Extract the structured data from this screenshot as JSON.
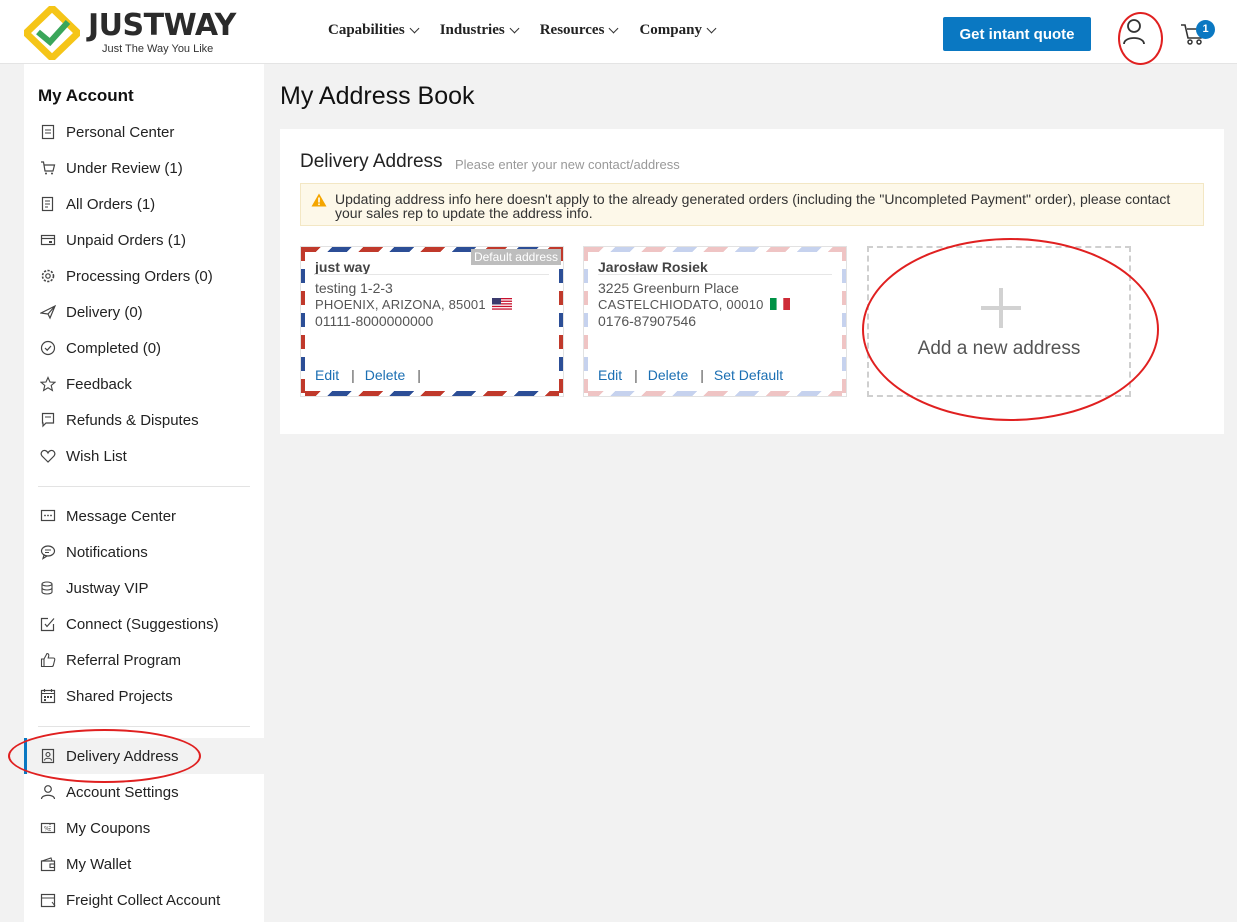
{
  "header": {
    "brand": "JUSTWAY",
    "tagline": "Just The Way You Like",
    "nav": [
      {
        "label": "Capabilities"
      },
      {
        "label": "Industries"
      },
      {
        "label": "Resources"
      },
      {
        "label": "Company"
      }
    ],
    "quote_button": "Get intant quote",
    "cart_count": "1"
  },
  "sidebar": {
    "title": "My Account",
    "group1": [
      {
        "label": "Personal Center",
        "icon": "document-icon"
      },
      {
        "label": "Under Review (1)",
        "icon": "cart-icon"
      },
      {
        "label": "All Orders (1)",
        "icon": "orders-icon"
      },
      {
        "label": "Unpaid Orders (1)",
        "icon": "card-icon"
      },
      {
        "label": "Processing Orders (0)",
        "icon": "gear-icon"
      },
      {
        "label": "Delivery (0)",
        "icon": "plane-icon"
      },
      {
        "label": "Completed (0)",
        "icon": "check-circle-icon"
      },
      {
        "label": "Feedback",
        "icon": "star-icon"
      },
      {
        "label": "Refunds & Disputes",
        "icon": "flag-icon"
      },
      {
        "label": "Wish List",
        "icon": "heart-icon"
      }
    ],
    "group2": [
      {
        "label": "Message Center",
        "icon": "message-icon"
      },
      {
        "label": "Notifications",
        "icon": "chat-icon"
      },
      {
        "label": "Justway VIP",
        "icon": "coins-icon"
      },
      {
        "label": "Connect (Suggestions)",
        "icon": "edit-check-icon"
      },
      {
        "label": "Referral Program",
        "icon": "thumbs-up-icon"
      },
      {
        "label": "Shared Projects",
        "icon": "calendar-icon"
      }
    ],
    "group3": [
      {
        "label": "Delivery Address",
        "icon": "address-book-icon"
      },
      {
        "label": "Account Settings",
        "icon": "user-icon"
      },
      {
        "label": "My Coupons",
        "icon": "coupon-icon"
      },
      {
        "label": "My Wallet",
        "icon": "wallet-icon"
      },
      {
        "label": "Freight Collect Account",
        "icon": "freight-icon"
      }
    ]
  },
  "main": {
    "title": "My Address Book",
    "section_title": "Delivery Address",
    "section_hint": "Please enter your new contact/address",
    "notice": "Updating address info here doesn't apply to the already generated orders (including the \"Uncompleted Payment\" order), please contact your sales rep to update the address info.",
    "addresses": [
      {
        "name": "just way",
        "default_tag": "Default address",
        "line1": "testing 1-2-3",
        "line2": "PHOENIX,  ARIZONA,  85001",
        "phone": "01111-8000000000",
        "flag": "us-flag-icon",
        "edit": "Edit",
        "delete": "Delete",
        "sep": "|"
      },
      {
        "name": "Jarosław Rosiek",
        "line1": "3225 Greenburn Place",
        "line2": "CASTELCHIODATO,  00010",
        "phone": "0176-87907546",
        "flag": "italy-flag-icon",
        "edit": "Edit",
        "delete": "Delete",
        "set_default": "Set Default",
        "sep": "|"
      }
    ],
    "add_label": "Add a new address"
  },
  "colors": {
    "accent": "#0a78c2",
    "annotation": "#e02020",
    "logo_yellow": "#f5c518",
    "logo_green": "#3aa65a"
  }
}
